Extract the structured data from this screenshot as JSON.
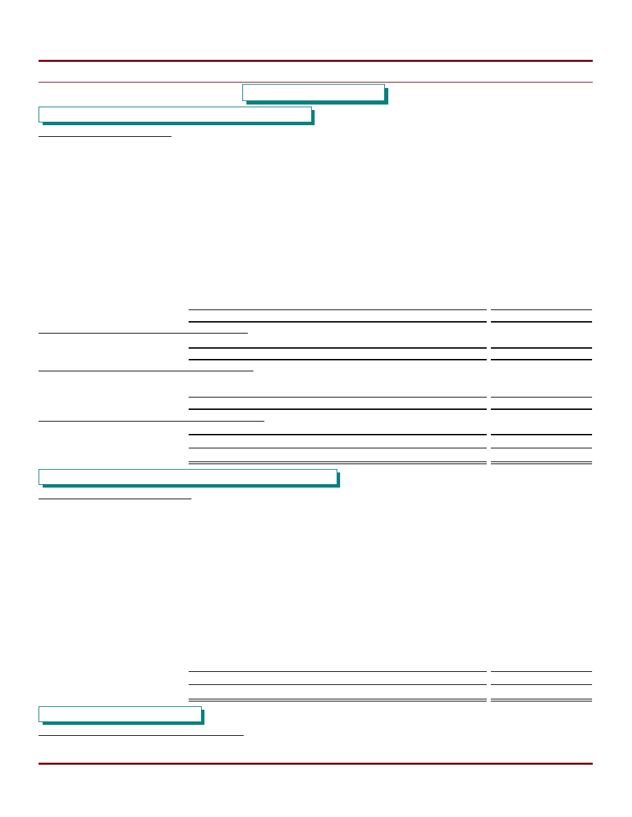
{
  "colors": {
    "accent_rule": "#7a0e14",
    "box_border": "#0a8080",
    "box_shadow": "#0a8080"
  }
}
